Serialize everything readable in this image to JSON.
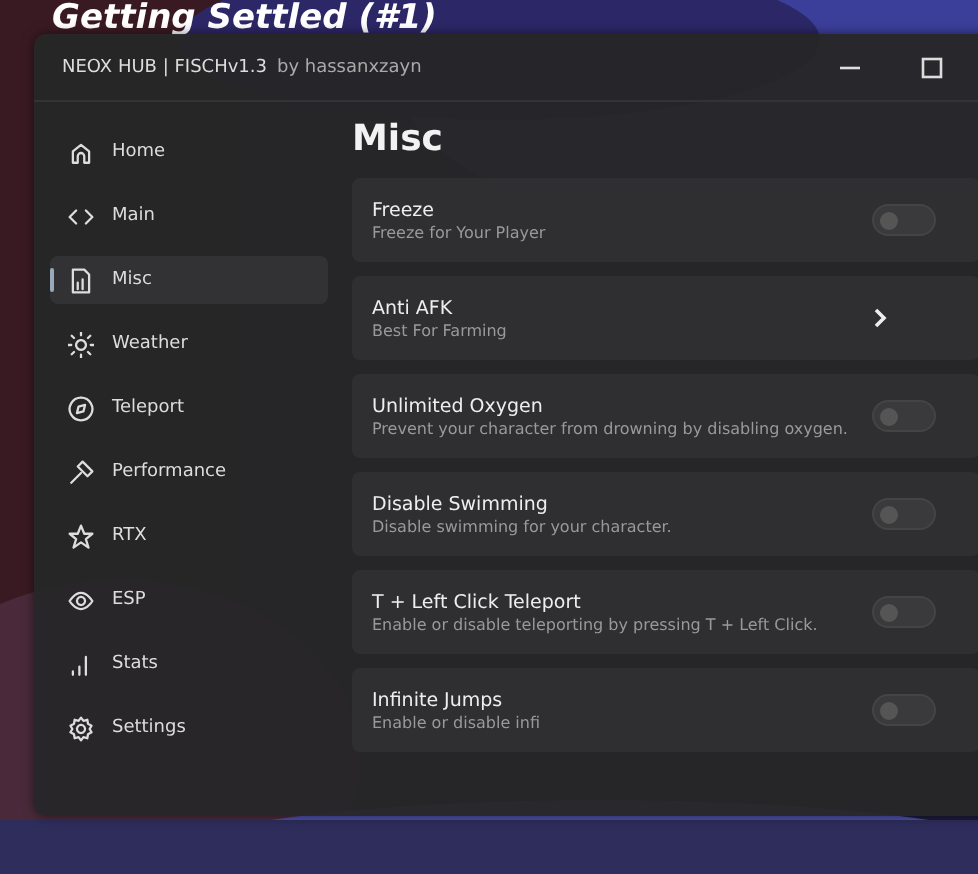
{
  "game": {
    "quest_title": "Getting Settled (#1)"
  },
  "window": {
    "title": "NEOX HUB | FISCHv1.3",
    "author": "by hassanxzayn"
  },
  "sidebar": {
    "items": [
      {
        "label": "Home",
        "selected": false
      },
      {
        "label": "Main",
        "selected": false
      },
      {
        "label": "Misc",
        "selected": true
      },
      {
        "label": "Weather",
        "selected": false
      },
      {
        "label": "Teleport",
        "selected": false
      },
      {
        "label": "Performance",
        "selected": false
      },
      {
        "label": "RTX",
        "selected": false
      },
      {
        "label": "ESP",
        "selected": false
      },
      {
        "label": "Stats",
        "selected": false
      },
      {
        "label": "Settings",
        "selected": false
      }
    ]
  },
  "content": {
    "heading": "Misc",
    "options": [
      {
        "kind": "toggle",
        "title": "Freeze",
        "description": "Freeze for Your Player",
        "on": false
      },
      {
        "kind": "link",
        "title": "Anti AFK",
        "description": "Best For Farming"
      },
      {
        "kind": "toggle",
        "title": "Unlimited Oxygen",
        "description": "Prevent your character from drowning by disabling oxygen.",
        "on": false
      },
      {
        "kind": "toggle",
        "title": "Disable Swimming",
        "description": "Disable swimming for your character.",
        "on": false
      },
      {
        "kind": "toggle",
        "title": "T + Left Click Teleport",
        "description": "Enable or disable teleporting by pressing T + Left Click.",
        "on": false
      },
      {
        "kind": "toggle",
        "title": "Infinite Jumps",
        "description": "Enable or disable infi",
        "on": false
      }
    ]
  }
}
